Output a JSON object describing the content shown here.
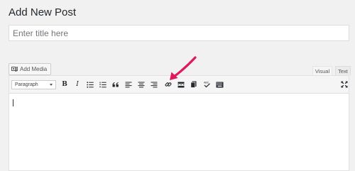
{
  "page": {
    "title": "Add New Post"
  },
  "title_field": {
    "placeholder": "Enter title here",
    "value": ""
  },
  "media": {
    "add_media_label": "Add Media",
    "icon": "camera-music-icon"
  },
  "editor_tabs": [
    {
      "label": "Visual",
      "active": true
    },
    {
      "label": "Text",
      "active": false
    }
  ],
  "toolbar": {
    "format_select": {
      "selected": "Paragraph"
    },
    "bold_label": "B",
    "italic_label": "I",
    "buttons": [
      {
        "name": "bold",
        "icon": "bold-icon"
      },
      {
        "name": "italic",
        "icon": "italic-icon"
      },
      {
        "name": "bulleted-list",
        "icon": "bulleted-list-icon"
      },
      {
        "name": "numbered-list",
        "icon": "numbered-list-icon"
      },
      {
        "name": "blockquote",
        "icon": "blockquote-icon"
      },
      {
        "name": "align-left",
        "icon": "align-left-icon"
      },
      {
        "name": "align-center",
        "icon": "align-center-icon"
      },
      {
        "name": "align-right",
        "icon": "align-right-icon"
      },
      {
        "name": "insert-link",
        "icon": "link-icon",
        "highlighted": true
      },
      {
        "name": "read-more",
        "icon": "read-more-icon"
      },
      {
        "name": "toolbar-toggle",
        "icon": "toolbar-toggle-icon"
      },
      {
        "name": "spellcheck",
        "icon": "spellcheck-icon"
      },
      {
        "name": "keyboard-shortcuts",
        "icon": "keyboard-icon"
      },
      {
        "name": "fullscreen",
        "icon": "fullscreen-icon"
      }
    ]
  },
  "annotation": {
    "arrow_color": "#e0195f",
    "target": "insert-link"
  },
  "colors": {
    "page_bg": "#f1f1f1",
    "editor_bg": "#ffffff",
    "toolbar_bg": "#f5f5f5",
    "text": "#23282d"
  }
}
